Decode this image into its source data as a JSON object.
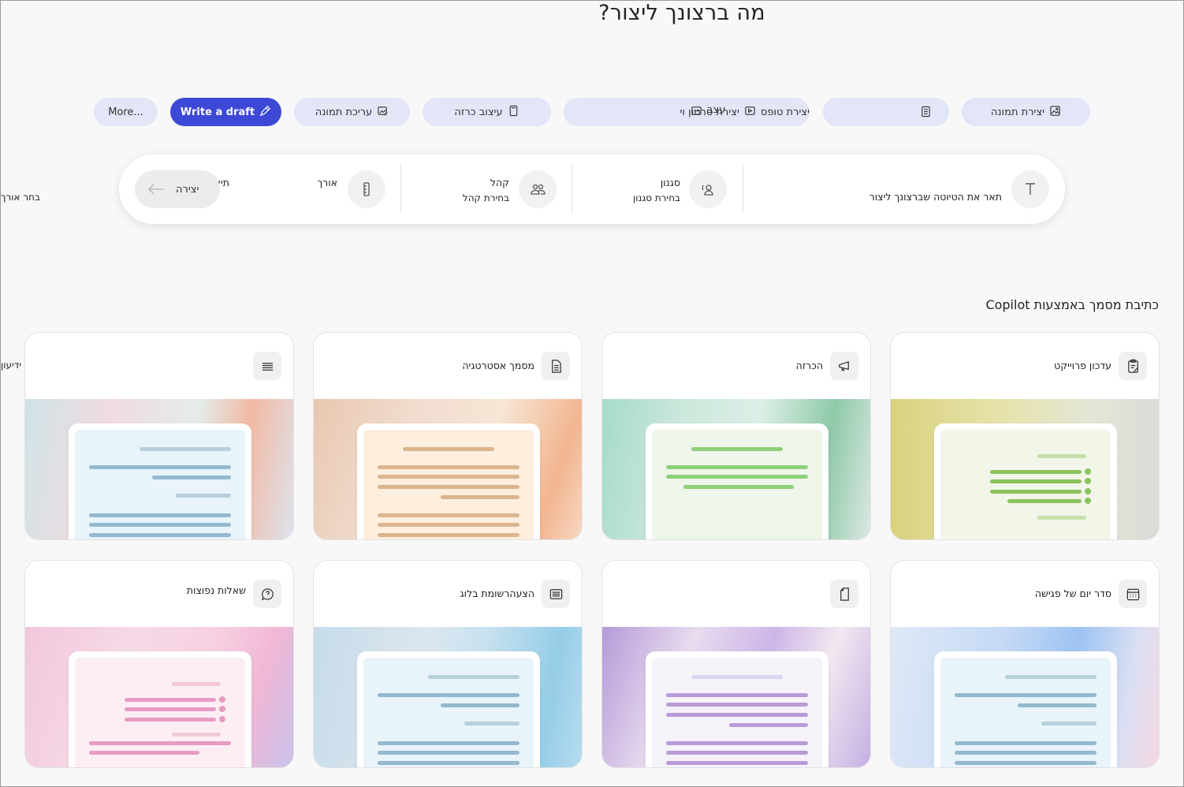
{
  "heading": "מה ברצונך ליצור?",
  "chips": [
    {
      "label": "More...",
      "icon": "more-icon"
    },
    {
      "label": "Write a draft",
      "icon": "pen-icon",
      "active": true
    },
    {
      "label": "עריכת תמונה",
      "icon": "image-edit-icon"
    },
    {
      "label": "עיצוב כרזה",
      "icon": "poster-icon"
    },
    {
      "label": "יצירת סרטון וי",
      "icon": "video-icon"
    },
    {
      "label": "יצירת טופס",
      "icon": "form-icon"
    },
    {
      "label": "עצב",
      "icon": "design-icon"
    },
    {
      "label": "יצירת תמונה",
      "icon": "image-icon"
    }
  ],
  "prompt_bar": {
    "describe_label": "תאר את הטיוטה שברצונך ליצור",
    "style_title": "סגנון",
    "style_sub": "בחירת סגנון",
    "audience_title": "קהל",
    "audience_sub": "בחירת קהל",
    "length_title": "אורך",
    "description_title": "תיאור",
    "create_label": "יצירה",
    "edge_label": "בחר אורך"
  },
  "section_title": "כתיבת מסמך באמצעות Copilot",
  "cards": [
    {
      "label": "עדכון פרוייקט",
      "icon": "clipboard-icon"
    },
    {
      "label": "הכרזה",
      "icon": "megaphone-icon"
    },
    {
      "label": "מסמך אסטרטגיה",
      "icon": "document-icon"
    },
    {
      "label": "",
      "icon": "text-lines-icon",
      "edge_label": "ידיעון"
    },
    {
      "label": "סדר יום של פגישה",
      "icon": "calendar-icon"
    },
    {
      "label": "",
      "icon": "page-icon"
    },
    {
      "label": "הצעהרשומת בלוג",
      "icon": "news-icon"
    },
    {
      "label": "שאלות נפוצות",
      "icon": "chat-question-icon"
    }
  ]
}
